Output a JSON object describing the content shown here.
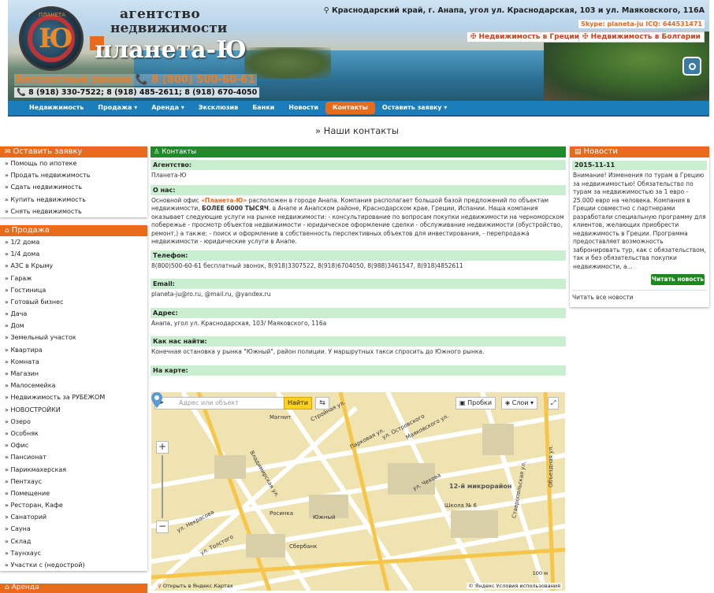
{
  "header": {
    "brand_line1": "агентство",
    "brand_line2": "недвижимости",
    "brand_name": "планета-Ю",
    "logo_letter": "Ю",
    "logo_small": "ПЛАНЕТА",
    "free_call": "Бесплатный звонок 📞 8 (800) 500-60-61",
    "phones": "📞 8 (918) 330-7522; 8 (918) 485-2611; 8 (918) 670-4050",
    "address": "Краснодарский край, г. Анапа, угол ул. Краснодарская, 103 и ул. Маяковского, 116А",
    "skype": "Skype: planeta-ju ICQ: 644531471",
    "greece_button": "Недвижимость в Греции",
    "bulgaria_button": "Недвижимость в Болгарии"
  },
  "nav": {
    "items": [
      {
        "label": "Недвижимость"
      },
      {
        "label": "Продажа ▾"
      },
      {
        "label": "Аренда ▾"
      },
      {
        "label": "Эксклюзив"
      },
      {
        "label": "Банки"
      },
      {
        "label": "Новости"
      },
      {
        "label": "Контакты"
      },
      {
        "label": "Оставить заявку ▾"
      }
    ]
  },
  "page_title": "» Наши контакты",
  "left": {
    "request_title": "Оставить заявку",
    "request_items": [
      "Помощь по ипотеке",
      "Продать недвижимость",
      "Сдать недвижимость",
      "Купить недвижимость",
      "Снять недвижимость"
    ],
    "sale_title": "Продажа",
    "sale_items": [
      "1/2 дома",
      "1/4 дома",
      "АЗС в Крыму",
      "Гараж",
      "Гостиница",
      "Готовый бизнес",
      "Дача",
      "Дом",
      "Земельный участок",
      "Квартира",
      "Комната",
      "Магазин",
      "Малосемейка",
      "Недвижимость за РУБЕЖОМ",
      "НОВОСТРОЙКИ",
      "Озеро",
      "Особняк",
      "Офис",
      "Пансионат",
      "Парикмахерская",
      "Пентхаус",
      "Помещение",
      "Ресторан, Кафе",
      "Санаторий",
      "Сауна",
      "Склад",
      "Таунхаус",
      "Участки с (недострой)"
    ],
    "rent_title": "Аренда"
  },
  "main": {
    "title": "Контакты",
    "agency_h": "Агентство:",
    "agency_t": "Планета-Ю",
    "about_h": "О нас:",
    "about_t1": "Основной офис ",
    "about_brand": "«Планета-Ю»",
    "about_t2": " расположен в городе Анапа. Компания располагает большой базой предложений по объектам недвижимости, ",
    "about_bold": "БОЛЕЕ 6000 ТЫСЯЧ",
    "about_t3": ". в Анапе и Анапском районе, Краснодарском крае, Греции, Испании. Наша компания оказывает следующие услуги на рынке недвижимости: - консультирование по вопросам покупки недвижимости на черноморском побережье - просмотр объектов недвижимости - юридическое оформление сделки - обслуживание недвижимости (обустройство, ремонт,) а также: - поиск и оформление в собственность перспективных объектов для инвестирования, - перепродажа недвижимости - юридические услуги в Анапе.",
    "phone_h": "Телефон:",
    "phone_t": "8(800)500-60-61 бесплатный звонок, 8(918)3307522, 8(918)6704050, 8(988)3461547, 8(918)4852611",
    "email_h": "Email:",
    "email_t": "planeta-ju@ro.ru, @mail.ru, @yandex.ru",
    "address_h": "Адрес:",
    "address_t": "Анапа, угол ул. Краснодарская, 103/ Маяковского, 116а",
    "howto_h": "Как нас найти:",
    "howto_t": "Конечная остановка у рынка \"Южный\", район полиции. У маршрутных такси спросить до Южного рынка.",
    "map_h": "На карте:"
  },
  "map": {
    "search_placeholder": "Адрес или объект",
    "find_button": "Найти",
    "traffic": "Пробки",
    "layers": "Слои ▾",
    "district_label": "12-й микрорайон",
    "open_link": "Открыть в Яндекс.Картах",
    "copyright": "© Яндекс Условия использования",
    "scale": "100 м",
    "streets": [
      "ул. Островского",
      "Парковая ул.",
      "Стройная ул.",
      "ул. Чехова",
      "Владимирская ул.",
      "ул. Некрасова",
      "ул. Толстого",
      "Маяковского ул.",
      "Объездная ул.",
      "Ставропольская ул."
    ],
    "poi": [
      "Магнит",
      "Южный",
      "Школа № 6",
      "Сбербанк",
      "Росинка"
    ]
  },
  "news": {
    "title": "Новости",
    "date": "2015-11-11",
    "text": "Внимание! Изменения по турам в Грецию за недвижимостью! Обязательство по турам за недвижимостью за 1 евро - 25.000 евро на человека. Компания в Греции совместно с партнерами разработали специальную программу для клиентов, желающих приобрести недвижимость в Греции. Программа предоставляет возможность забронировать тур, как с обязательством, так и без обязательства покупки недвижимости, а...",
    "read_button": "Читать новость",
    "all_news": "Читать все новости"
  }
}
